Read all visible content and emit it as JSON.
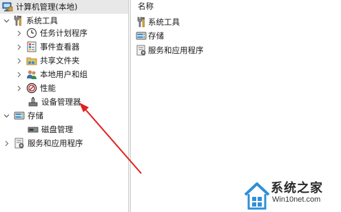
{
  "tree": {
    "root": {
      "label": "计算机管理(本地)",
      "icon": "computer-management-icon"
    },
    "system_tools": {
      "label": "系统工具",
      "icon": "tools-icon",
      "expanded": true
    },
    "task_scheduler": {
      "label": "任务计划程序",
      "icon": "clock-icon"
    },
    "event_viewer": {
      "label": "事件查看器",
      "icon": "event-viewer-icon"
    },
    "shared_folders": {
      "label": "共享文件夹",
      "icon": "shared-folder-icon"
    },
    "local_users": {
      "label": "本地用户和组",
      "icon": "users-icon"
    },
    "performance": {
      "label": "性能",
      "icon": "performance-icon"
    },
    "device_manager": {
      "label": "设备管理器",
      "icon": "device-manager-icon"
    },
    "storage": {
      "label": "存储",
      "icon": "storage-icon",
      "expanded": true
    },
    "disk_management": {
      "label": "磁盘管理",
      "icon": "disk-icon"
    },
    "services_apps": {
      "label": "服务和应用程序",
      "icon": "services-icon"
    }
  },
  "list": {
    "column_header": "名称",
    "items": [
      {
        "label": "系统工具",
        "icon": "tools-icon"
      },
      {
        "label": "存储",
        "icon": "storage-icon"
      },
      {
        "label": "服务和应用程序",
        "icon": "services-icon"
      }
    ]
  },
  "annotation": {
    "arrow_color": "#e02020"
  },
  "watermark": {
    "title": "系统之家",
    "url": "Win10net.com"
  },
  "colors": {
    "selected_row": "#e8e8e8",
    "splitter": "#f0f0f0",
    "accent_blue": "#2f8fd8"
  }
}
